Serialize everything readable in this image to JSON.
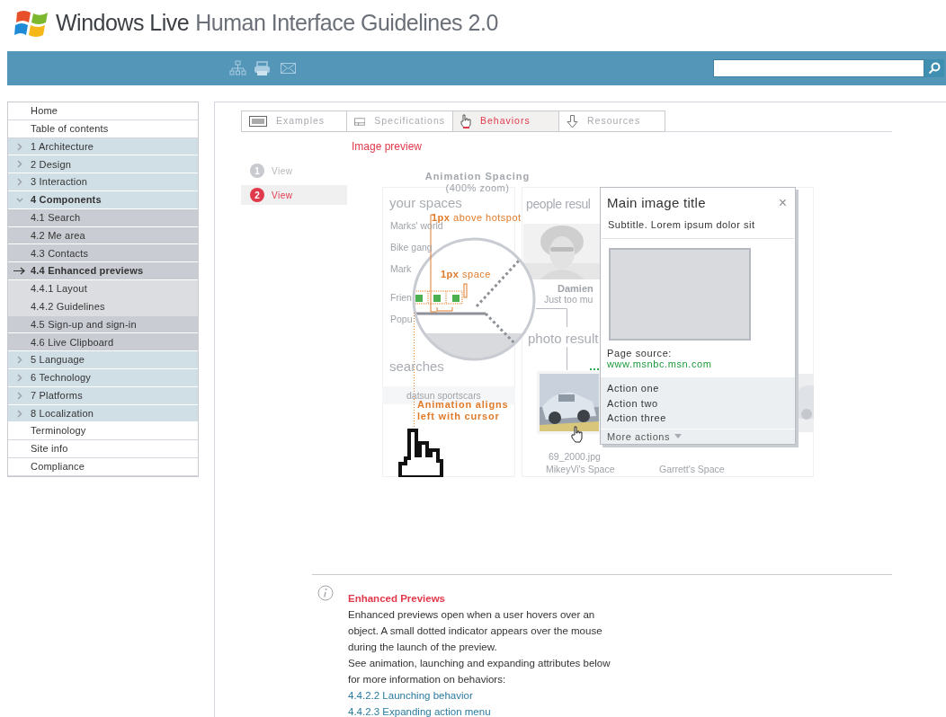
{
  "header": {
    "brand": "Windows Live",
    "title": "Human Interface Guidelines 2.0"
  },
  "sidebar": {
    "items": [
      {
        "label": "Home",
        "kind": "page",
        "selected": false
      },
      {
        "label": "Table of contents",
        "kind": "page",
        "selected": false
      },
      {
        "label": "1 Architecture",
        "kind": "chapter",
        "expanded": false,
        "selected": false
      },
      {
        "label": "2 Design",
        "kind": "chapter",
        "expanded": false,
        "selected": false
      },
      {
        "label": "3 Interaction",
        "kind": "chapter",
        "expanded": false,
        "selected": false
      },
      {
        "label": "4 Components",
        "kind": "chapter",
        "expanded": true,
        "selected": false
      },
      {
        "label": "4.1 Search",
        "kind": "section",
        "selected": false
      },
      {
        "label": "4.2 Me area",
        "kind": "section",
        "selected": false
      },
      {
        "label": "4.3 Contacts",
        "kind": "section",
        "selected": false
      },
      {
        "label": "4.4 Enhanced previews",
        "kind": "section",
        "selected": true
      },
      {
        "label": "4.4.1 Layout",
        "kind": "subsection",
        "selected": false
      },
      {
        "label": "4.4.2 Guidelines",
        "kind": "subsection",
        "selected": false
      },
      {
        "label": "4.5 Sign-up and sign-in",
        "kind": "section",
        "selected": false
      },
      {
        "label": "4.6 Live Clipboard",
        "kind": "section",
        "selected": false
      },
      {
        "label": "5 Language",
        "kind": "chapter",
        "expanded": false,
        "selected": false
      },
      {
        "label": "6 Technology",
        "kind": "chapter",
        "expanded": false,
        "selected": false
      },
      {
        "label": "7 Platforms",
        "kind": "chapter",
        "expanded": false,
        "selected": false
      },
      {
        "label": "8 Localization",
        "kind": "chapter",
        "expanded": false,
        "selected": false
      },
      {
        "label": "Terminology",
        "kind": "page",
        "selected": false
      },
      {
        "label": "Site info",
        "kind": "page",
        "selected": false
      },
      {
        "label": "Compliance",
        "kind": "page",
        "selected": false
      }
    ]
  },
  "tabs": [
    {
      "label": "Examples",
      "selected": false
    },
    {
      "label": "Specifications",
      "selected": false
    },
    {
      "label": "Behaviors",
      "selected": true
    },
    {
      "label": "Resources",
      "selected": false
    }
  ],
  "section_title": "Image preview",
  "steps": [
    {
      "number": "1",
      "label": "View",
      "selected": false
    },
    {
      "number": "2",
      "label": "View",
      "selected": true
    }
  ],
  "diagram": {
    "title": "Animation Spacing",
    "subtitle": "(400% zoom)",
    "background_texts": [
      {
        "text": "your spaces",
        "kind": "heading"
      },
      {
        "text": "Marks' world",
        "kind": "item"
      },
      {
        "text": "Bike gang",
        "kind": "item"
      },
      {
        "text": "Mark",
        "kind": "item"
      },
      {
        "text": "Frien",
        "kind": "item"
      },
      {
        "text": "Popu",
        "kind": "item"
      },
      {
        "text": "searches",
        "kind": "heading"
      },
      {
        "text": "datsun sportscars",
        "kind": "item"
      },
      {
        "text": "people resul",
        "kind": "heading"
      },
      {
        "text": "Damien",
        "kind": "name"
      },
      {
        "text": "Just too mu",
        "kind": "item"
      },
      {
        "text": "photo result",
        "kind": "heading"
      },
      {
        "text": "69_2000.jpg",
        "kind": "item"
      },
      {
        "text": "MikeyVi's Space",
        "kind": "item"
      },
      {
        "text": "Garrett's Space",
        "kind": "item"
      }
    ],
    "annotations": [
      "**1px** above hotspot",
      "**1px** space",
      "Animation aligns left with cursor"
    ],
    "popup": {
      "title": "Main image title",
      "close": "×",
      "subtitle": "Subtitle. Lorem ipsum dolor sit",
      "source_label": "Page source:",
      "source_link": "www.msnbc.msn.com",
      "actions": [
        "Action one",
        "Action two",
        "Action three"
      ],
      "more": "More actions"
    }
  },
  "note": {
    "title": "Enhanced Previews",
    "paragraphs": [
      "Enhanced previews open when a user hovers over an object. A small dotted indicator appears over the mouse during the launch of the preview.",
      "See animation, launching and expanding attributes below for more information on behaviors:"
    ],
    "links": [
      "4.4.2.2 Launching behavior",
      "4.4.2.3 Expanding action menu"
    ]
  }
}
